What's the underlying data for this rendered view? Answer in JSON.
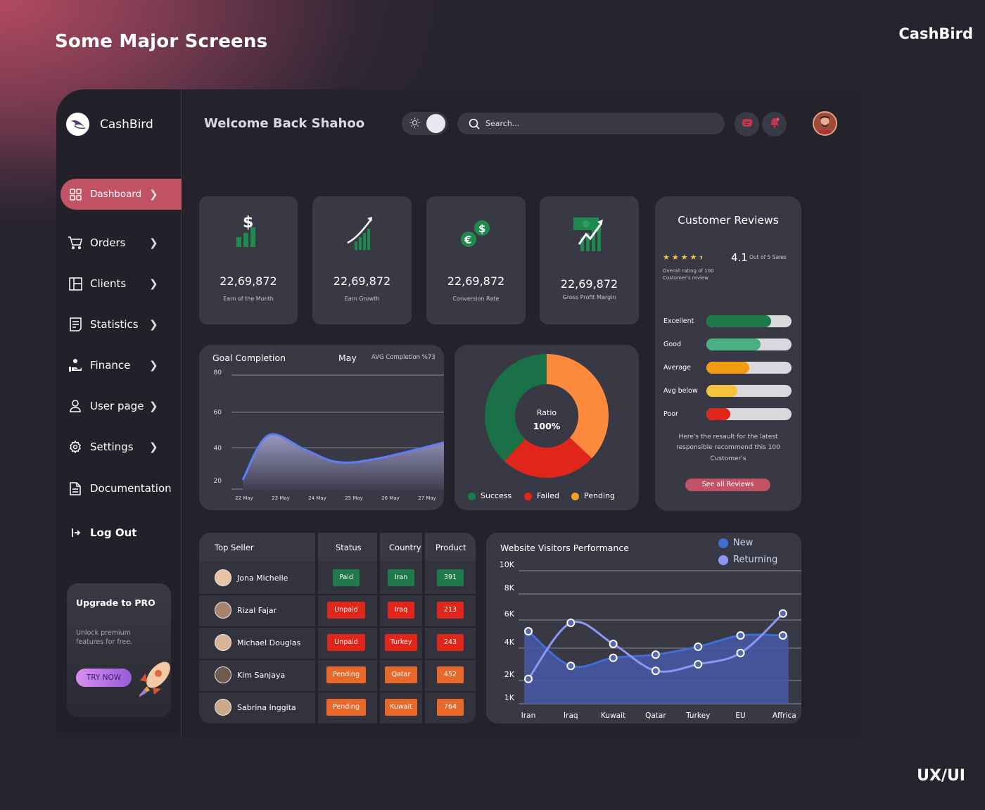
{
  "header": {
    "title": "Some Major Screens",
    "brand": "CashBird",
    "footer_tag": "UX/UI"
  },
  "sidebar": {
    "logo_text": "CashBird",
    "items": [
      {
        "label": "Dashboard",
        "icon": "grid-icon"
      },
      {
        "label": "Orders",
        "icon": "cart-icon"
      },
      {
        "label": "Clients",
        "icon": "layout-icon"
      },
      {
        "label": "Statistics",
        "icon": "document-icon"
      },
      {
        "label": "Finance",
        "icon": "hand-coin-icon"
      },
      {
        "label": "User page",
        "icon": "user-icon"
      },
      {
        "label": "Settings",
        "icon": "gear-icon"
      },
      {
        "label": "Documentation",
        "icon": "file-text-icon"
      },
      {
        "label": "Log Out",
        "icon": "logout-icon"
      }
    ],
    "upgrade": {
      "title": "Upgrade to PRO",
      "text_line1": "Unlock premium",
      "text_line2": "features for free.",
      "button": "TRY NOW"
    }
  },
  "topbar": {
    "welcome": "Welcome Back Shahoo",
    "search_placeholder": "Search..."
  },
  "stats": [
    {
      "value": "22,69,872",
      "label": "Earn of the Month",
      "icon": "dollar-bars-icon"
    },
    {
      "value": "22,69,872",
      "label": "Earn Growth",
      "icon": "growth-arrow-icon"
    },
    {
      "value": "22,69,872",
      "label": "Conversion Rate",
      "icon": "currency-exchange-icon"
    },
    {
      "value": "22,69,872",
      "label": "Gross Profit Margin",
      "icon": "profit-chart-icon"
    }
  ],
  "reviews": {
    "title": "Customer Reviews",
    "stars": 4.5,
    "rating": "4.1",
    "rating_sub": "Out of 5 Sales",
    "overall_line1": "Overall rating of 100",
    "overall_line2": "Customer's review",
    "rows": [
      {
        "label": "Excellent",
        "fill": 0.76,
        "color": "#1d7a4a"
      },
      {
        "label": "Good",
        "fill": 0.64,
        "color": "#4bb081"
      },
      {
        "label": "Average",
        "fill": 0.5,
        "color": "#f39c12"
      },
      {
        "label": "Avg below",
        "fill": 0.36,
        "color": "#f7c23c"
      },
      {
        "label": "Poor",
        "fill": 0.28,
        "color": "#e0251b"
      }
    ],
    "note_line1": "Here's the resault for the latest",
    "note_line2": "responsible recommend this 100",
    "note_line3": "Customer's",
    "button": "See all Reviews"
  },
  "goal": {
    "title": "Goal Completion",
    "month": "May",
    "avg": "AVG Completion %73"
  },
  "ratio": {
    "center_label": "Ratio",
    "center_value": "100%",
    "legend": [
      {
        "label": "Success",
        "color": "#1e7a4b"
      },
      {
        "label": "Failed",
        "color": "#e0251b"
      },
      {
        "label": "Pending",
        "color": "#f0a425"
      }
    ]
  },
  "table": {
    "headers": [
      "Top Seller",
      "Status",
      "Country",
      "Product"
    ],
    "rows": [
      {
        "name": "Jona Michelle",
        "status": "Paid",
        "country": "Iran",
        "product": "391",
        "color": "#1d7a4a"
      },
      {
        "name": "Rizal Fajar",
        "status": "Unpaid",
        "country": "Iraq",
        "product": "213",
        "color": "#e0251b"
      },
      {
        "name": "Michael Douglas",
        "status": "Unpaid",
        "country": "Turkey",
        "product": "243",
        "color": "#e0251b"
      },
      {
        "name": "Kim Sanjaya",
        "status": "Pending",
        "country": "Qatar",
        "product": "452",
        "color": "#e8682a"
      },
      {
        "name": "Sabrina Inggita",
        "status": "Pending",
        "country": "Kuwait",
        "product": "764",
        "color": "#e8682a"
      }
    ]
  },
  "visitors": {
    "title": "Website Visitors Performance",
    "legend": [
      {
        "label": "New",
        "color": "#3f6ed4"
      },
      {
        "label": "Returning",
        "color": "#8b97f5"
      }
    ]
  },
  "chart_data": [
    {
      "type": "area",
      "title": "Goal Completion",
      "categories": [
        "22 May",
        "23 May",
        "24 May",
        "25 May",
        "26 May",
        "27 May"
      ],
      "x": [
        0,
        0.7,
        1.7,
        2.6,
        3.7,
        5.5
      ],
      "values": [
        22,
        47,
        39,
        32,
        34,
        43
      ],
      "yticks": [
        20,
        40,
        60,
        80
      ],
      "ylim": [
        20,
        80
      ],
      "grid": true,
      "color": "#5d7ef5"
    },
    {
      "type": "pie",
      "donut": true,
      "slices": [
        {
          "label": "Pending",
          "value": 37,
          "color": "#fd8a3d"
        },
        {
          "label": "Failed",
          "value": 25,
          "color": "#e0251b"
        },
        {
          "label": "Success",
          "value": 38,
          "color": "#1a7047"
        }
      ]
    },
    {
      "type": "area",
      "title": "Website Visitors Performance",
      "categories": [
        "Iran",
        "Iraq",
        "Kuwait",
        "Qatar",
        "Turkey",
        "EU",
        "Affrica"
      ],
      "yticks": [
        "1K",
        "2K",
        "4K",
        "6K",
        "8K",
        "10K"
      ],
      "series": [
        {
          "name": "New",
          "values": [
            5200,
            2900,
            3400,
            3600,
            4100,
            4900,
            4900
          ],
          "color": "#3f6ed4"
        },
        {
          "name": "Returning",
          "values": [
            2100,
            5800,
            4300,
            2600,
            3000,
            3700,
            6500
          ],
          "color": "#8b97f5"
        }
      ],
      "legend": "top-right",
      "grid": true
    }
  ]
}
